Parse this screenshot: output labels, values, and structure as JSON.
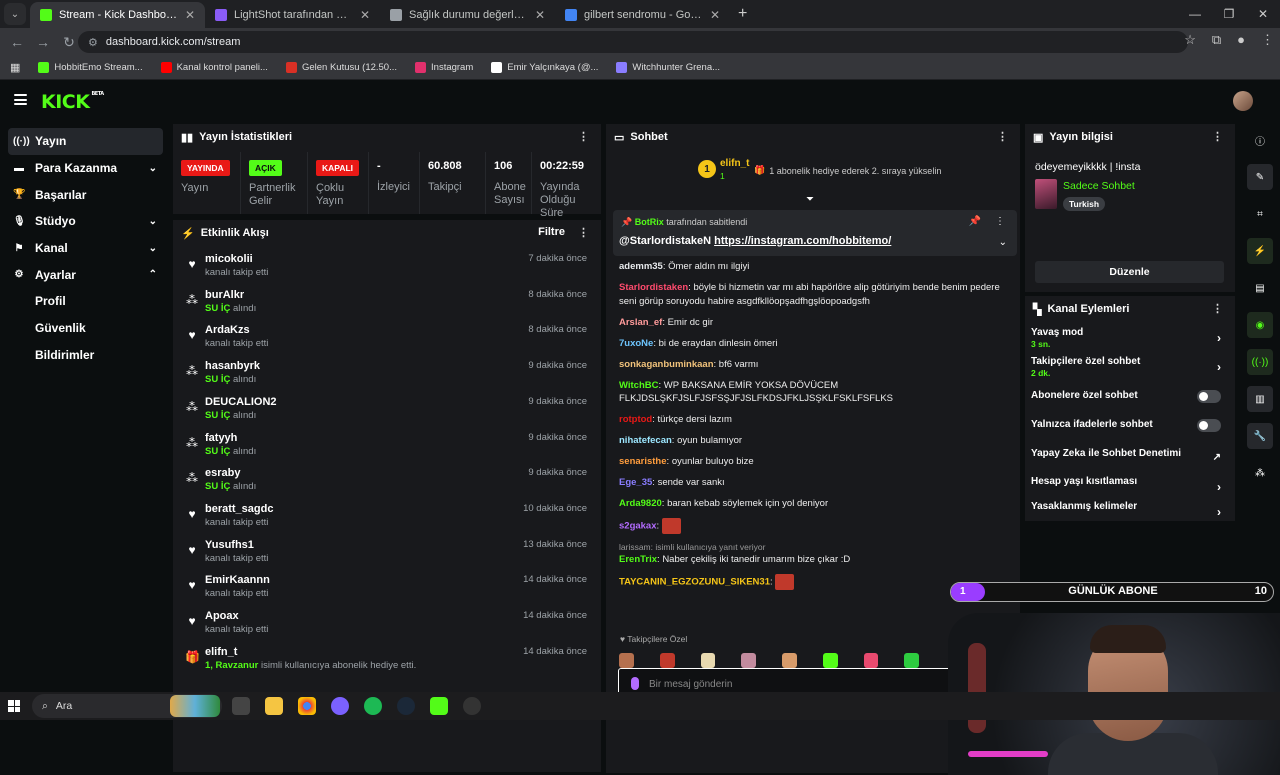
{
  "browser": {
    "tabs": [
      {
        "title": "Stream - Kick Dashboard",
        "color": "#53fc18",
        "active": true
      },
      {
        "title": "LightShot tarafından Ekran Görü",
        "color": "#8a5cf6",
        "active": false
      },
      {
        "title": "Sağlık durumu değerlendirmesi",
        "color": "#9aa0a6",
        "active": false
      },
      {
        "title": "gilbert sendromu - Google'da Ar",
        "color": "#4285f4",
        "active": false
      }
    ],
    "url": "dashboard.kick.com/stream",
    "bookmarks": [
      "HobbitEmo Stream...",
      "Kanal kontrol paneli...",
      "Gelen Kutusu (12.50...",
      "Instagram",
      "Emir Yalçınkaya (@...",
      "Witchhunter Grena..."
    ]
  },
  "logo": "KICK",
  "logo_sup": "BETA",
  "nav": {
    "items": [
      {
        "label": "Yayın",
        "icon": "broadcast-icon",
        "glyph": "((·))",
        "active": true,
        "chev": ""
      },
      {
        "label": "Para Kazanma",
        "icon": "money-icon",
        "glyph": "▬",
        "active": false,
        "chev": "⌄"
      },
      {
        "label": "Başarılar",
        "icon": "trophy-icon",
        "glyph": "🏆",
        "active": false,
        "chev": ""
      },
      {
        "label": "Stüdyo",
        "icon": "studio-icon",
        "glyph": "🎙",
        "active": false,
        "chev": "⌄"
      },
      {
        "label": "Kanal",
        "icon": "channel-icon",
        "glyph": "⚑",
        "active": false,
        "chev": "⌄"
      },
      {
        "label": "Ayarlar",
        "icon": "gear-icon",
        "glyph": "⚙",
        "active": false,
        "chev": "⌃"
      }
    ],
    "sub_items": [
      "Profil",
      "Güvenlik",
      "Bildirimler"
    ]
  },
  "stats": {
    "title": "Yayın İstatistikleri",
    "cells": [
      {
        "badge": "YAYINDA",
        "badge_color": "#e91916",
        "badge_text_color": "#ffffff",
        "value": "",
        "label": "Yayın"
      },
      {
        "badge": "AÇIK",
        "badge_color": "#53fc18",
        "badge_text_color": "#0b0e0f",
        "value": "",
        "label": "Partnerlik Gelir"
      },
      {
        "badge": "KAPALI",
        "badge_color": "#e91916",
        "badge_text_color": "#ffffff",
        "value": "",
        "label": "Çoklu Yayın"
      },
      {
        "badge": "",
        "value": "-",
        "label": "İzleyici"
      },
      {
        "badge": "",
        "value": "60.808",
        "label": "Takipçi"
      },
      {
        "badge": "",
        "value": "106",
        "label": "Abone Sayısı"
      },
      {
        "badge": "",
        "value": "00:22:59",
        "label": "Yayında Olduğu Süre"
      }
    ]
  },
  "activity": {
    "title": "Etkinlik Akışı",
    "filter": "Filtre",
    "rows": [
      {
        "name": "micokolii",
        "sub_pre": "",
        "sub_hl": "",
        "sub_post": "kanalı takip etti",
        "time": "7 dakika önce",
        "type": "follow"
      },
      {
        "name": "burAlkr",
        "sub_pre": "",
        "sub_hl": "SU İÇ",
        "sub_post": " alındı",
        "time": "8 dakika önce",
        "type": "reward"
      },
      {
        "name": "ArdaKzs",
        "sub_pre": "",
        "sub_hl": "",
        "sub_post": "kanalı takip etti",
        "time": "8 dakika önce",
        "type": "follow"
      },
      {
        "name": "hasanbyrk",
        "sub_pre": "",
        "sub_hl": "SU İÇ",
        "sub_post": " alındı",
        "time": "9 dakika önce",
        "type": "reward"
      },
      {
        "name": "DEUCALION2",
        "sub_pre": "",
        "sub_hl": "SU İÇ",
        "sub_post": " alındı",
        "time": "9 dakika önce",
        "type": "reward"
      },
      {
        "name": "fatyyh",
        "sub_pre": "",
        "sub_hl": "SU İÇ",
        "sub_post": " alındı",
        "time": "9 dakika önce",
        "type": "reward"
      },
      {
        "name": "esraby",
        "sub_pre": "",
        "sub_hl": "SU İÇ",
        "sub_post": " alındı",
        "time": "9 dakika önce",
        "type": "reward"
      },
      {
        "name": "beratt_sagdc",
        "sub_pre": "",
        "sub_hl": "",
        "sub_post": "kanalı takip etti",
        "time": "10 dakika önce",
        "type": "follow"
      },
      {
        "name": "Yusufhs1",
        "sub_pre": "",
        "sub_hl": "",
        "sub_post": "kanalı takip etti",
        "time": "13 dakika önce",
        "type": "follow"
      },
      {
        "name": "EmirKaannn",
        "sub_pre": "",
        "sub_hl": "",
        "sub_post": "kanalı takip etti",
        "time": "14 dakika önce",
        "type": "follow"
      },
      {
        "name": "Apoax",
        "sub_pre": "",
        "sub_hl": "",
        "sub_post": "kanalı takip etti",
        "time": "14 dakika önce",
        "type": "follow"
      },
      {
        "name": "elifn_t",
        "sub_pre": "",
        "sub_hl": "1, Ravzanur",
        "sub_post": " isimli kullanıcıya abonelik hediye etti.",
        "time": "14 dakika önce",
        "type": "gift"
      }
    ]
  },
  "chat": {
    "title": "Sohbet",
    "top_user": "elifn_t",
    "top_user_count": "1",
    "top_badge": "1",
    "sub_info": "1 abonelik hediye ederek 2. sıraya yükselin",
    "pinned_by": "BotRix",
    "pinned_by_suffix": " tarafından sabitlendi",
    "pinned_mention": "@StarlordistakeN ",
    "pinned_link": "https://instagram.com/hobbitemo/",
    "messages": [
      {
        "user": "ademm35",
        "color": "#e8eaed",
        "text": "Ömer aldın mı ilgiyi",
        "reply": ""
      },
      {
        "user": "Starlordistaken",
        "color": "#ff4b6e",
        "text": "böyle bi hizmetin var mı abi hapörlöre alip götüriyim bende benim pedere seni görüp soruyodu habire asgdfkllöopşadfhgşlöopoadgsfh",
        "reply": ""
      },
      {
        "user": "Arslan_ef",
        "color": "#ff9b9b",
        "text": "Emir dc gir",
        "reply": ""
      },
      {
        "user": "7uxoNe",
        "color": "#6ec6ff",
        "text": "bi de eraydan dinlesin ömeri",
        "reply": ""
      },
      {
        "user": "sonkaganbuminkaan",
        "color": "#f0c27b",
        "text": "bf6 varmı",
        "reply": ""
      },
      {
        "user": "WitchBC",
        "color": "#53fc18",
        "text": "WP BAKSANA EMİR YOKSA DÖVÜCEM FLKJDSLŞKFJSLFJSFSŞJFJSLFKDSJFKLJSŞKLFSKLFSFLKS",
        "reply": ""
      },
      {
        "user": "rotptod",
        "color": "#e91916",
        "text": "türkçe dersi lazım",
        "reply": ""
      },
      {
        "user": "nihatefecan",
        "color": "#9de7ff",
        "text": "oyun bulamıyor",
        "reply": ""
      },
      {
        "user": "senaristhe",
        "color": "#ff9d3d",
        "text": "oyunlar buluyo bize",
        "reply": ""
      },
      {
        "user": "Ege_35",
        "color": "#8a7dff",
        "text": "sende var sankı",
        "reply": ""
      },
      {
        "user": "Arda9820",
        "color": "#53fc18",
        "text": "baran kebab söylemek için yol deniyor",
        "reply": ""
      },
      {
        "user": "s2gakax",
        "color": "#b36cff",
        "text": "",
        "reply": ""
      },
      {
        "user": "ErenTrix",
        "color": "#53fc18",
        "text": "Naber çekiliş iki tanedir umarım bize çıkar :D",
        "reply": "larissam: isimli kullanıcıya yanıt veriyor"
      },
      {
        "user": "TAYCANIN_EGZOZUNU_SIKEN31",
        "color": "#f5c518",
        "text": "",
        "reply": ""
      }
    ],
    "followers_only": "Takipçilere Özel",
    "input_placeholder": "Bir mesaj gönderin"
  },
  "info": {
    "title": "Yayın bilgisi",
    "stream_title": "ödeyemeyikkkk | !insta",
    "category": "Sadece Sohbet",
    "tag": "Turkish",
    "edit": "Düzenle"
  },
  "actions": {
    "title": "Kanal Eylemleri",
    "rows": [
      {
        "label": "Yavaş mod",
        "sub": "3 sn.",
        "kind": "arrow"
      },
      {
        "label": "Takipçilere özel sohbet",
        "sub": "2 dk.",
        "kind": "arrow"
      },
      {
        "label": "Abonelere özel sohbet",
        "sub": "",
        "kind": "toggle"
      },
      {
        "label": "Yalnızca ifadelerle sohbet",
        "sub": "",
        "kind": "toggle"
      },
      {
        "label": "Yapay Zeka ile Sohbet Denetimi",
        "sub": "",
        "kind": "ext"
      },
      {
        "label": "Hesap yaşı kısıtlaması",
        "sub": "",
        "kind": "arrow"
      },
      {
        "label": "Yasaklanmış kelimeler",
        "sub": "",
        "kind": "arrow"
      }
    ]
  },
  "goal": {
    "left": "1",
    "title": "GÜNLÜK ABONE",
    "right": "10",
    "progress": 0.1
  },
  "taskbar": {
    "search": "Ara"
  },
  "colors": {
    "kick_green": "#53fc18",
    "panel": "#18191c",
    "bg": "#0b0e0f"
  }
}
